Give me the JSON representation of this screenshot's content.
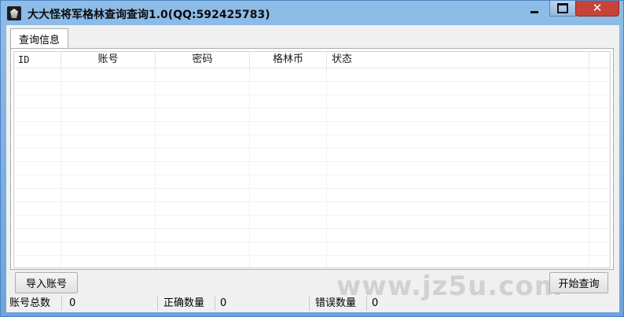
{
  "window": {
    "title": "大大怪将军格林查询查询1.0(QQ:592425783)",
    "close_symbol": "✕"
  },
  "tabs": [
    {
      "label": "查询信息",
      "selected": true
    }
  ],
  "table": {
    "columns": [
      "ID",
      "账号",
      "密码",
      "格林币",
      "状态"
    ],
    "rows": []
  },
  "buttons": {
    "import": "导入账号",
    "start": "开始查询"
  },
  "watermark": "www.jz5u.com",
  "status": {
    "total_label": "账号总数",
    "total_value": "0",
    "correct_label": "正确数量",
    "correct_value": "0",
    "error_label": "错误数量",
    "error_value": "0"
  }
}
